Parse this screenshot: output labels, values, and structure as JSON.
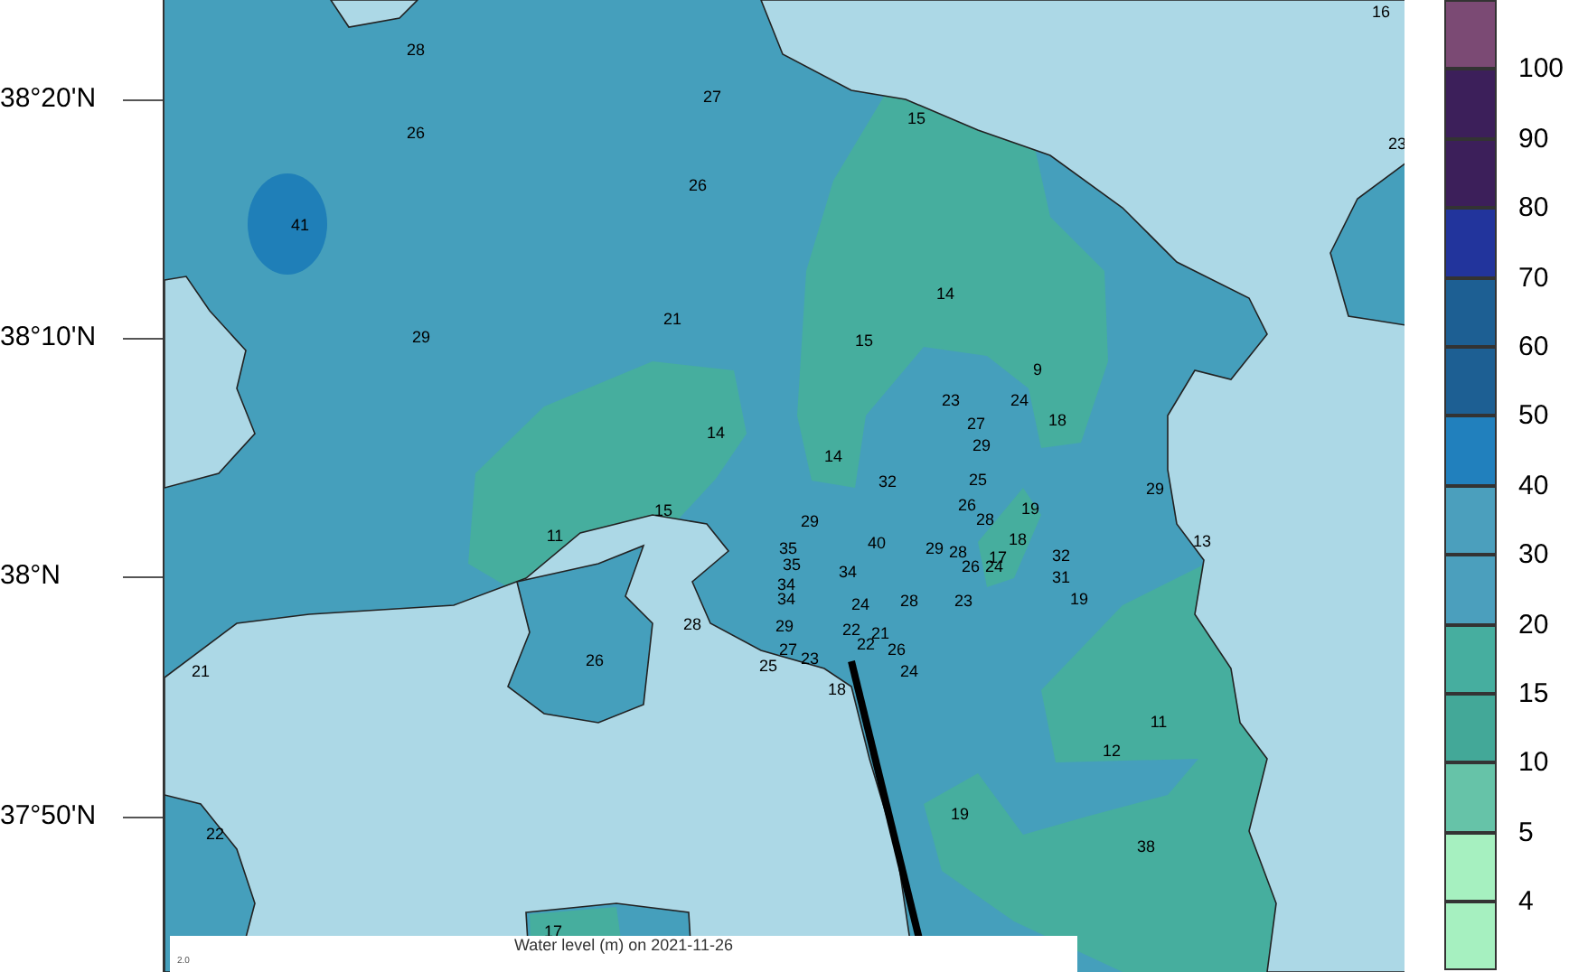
{
  "map": {
    "latitude_labels": [
      "38°20'N",
      "38°10'N",
      "38°N",
      "37°50'N"
    ],
    "values": [
      "16",
      "28",
      "27",
      "26",
      "15",
      "26",
      "23",
      "41",
      "21",
      "29",
      "14",
      "15",
      "9",
      "23",
      "24",
      "18",
      "27",
      "29",
      "14",
      "14",
      "32",
      "25",
      "29",
      "26",
      "19",
      "28",
      "15",
      "11",
      "29",
      "40",
      "18",
      "35",
      "29",
      "28",
      "17",
      "26",
      "24",
      "32",
      "35",
      "34",
      "31",
      "13",
      "34",
      "34",
      "24",
      "28",
      "23",
      "19",
      "28",
      "29",
      "22",
      "21",
      "22",
      "26",
      "26",
      "27",
      "23",
      "25",
      "18",
      "21",
      "24",
      "11",
      "12",
      "22",
      "19",
      "38",
      "17"
    ],
    "inset": {
      "title": "Water level (m) on 2021-11-26",
      "y_tick": "2.0"
    }
  },
  "colorbar": {
    "bands": [
      {
        "color": "#7b4a74",
        "label": "100"
      },
      {
        "color": "#3c1f5a",
        "label": "90"
      },
      {
        "color": "#3c1f5a",
        "label": "80"
      },
      {
        "color": "#22349c",
        "label": "70"
      },
      {
        "color": "#1d5f93",
        "label": "60"
      },
      {
        "color": "#1d5f93",
        "label": "50"
      },
      {
        "color": "#2180bd",
        "label": "40"
      },
      {
        "color": "#4b9fbd",
        "label": "30"
      },
      {
        "color": "#4b9fbd",
        "label": "20"
      },
      {
        "color": "#46ae9f",
        "label": "15"
      },
      {
        "color": "#43a898",
        "label": "10"
      },
      {
        "color": "#66c3a8",
        "label": "5"
      },
      {
        "color": "#a6f0c0",
        "label": "4"
      },
      {
        "color": "#a6f0c0"
      }
    ]
  }
}
